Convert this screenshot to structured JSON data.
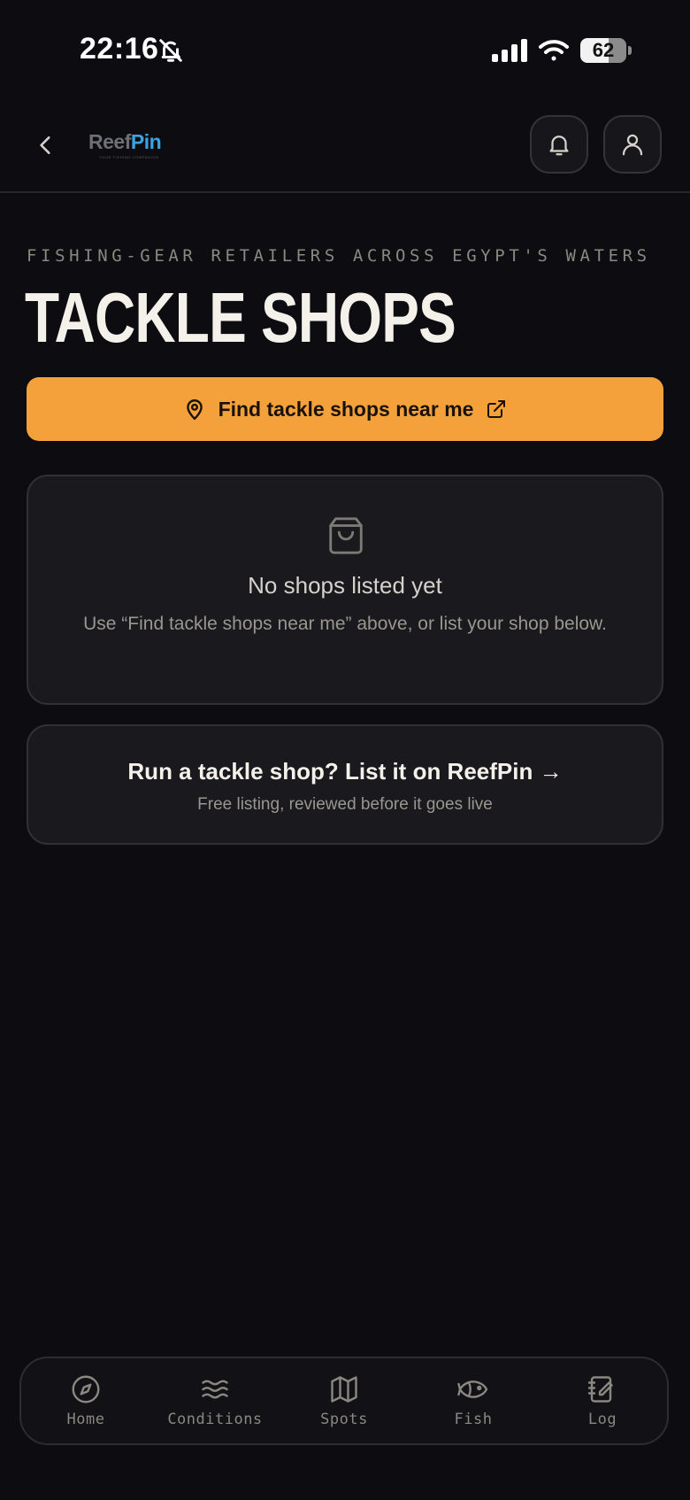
{
  "status_bar": {
    "time": "22:16",
    "battery": "62"
  },
  "header": {
    "logo_primary": "Reef",
    "logo_accent": "Pin",
    "logo_tagline": "YOUR FISHING COMPANION"
  },
  "page": {
    "eyebrow": "FISHING-GEAR RETAILERS ACROSS EGYPT'S WATERS",
    "title": "TACKLE SHOPS",
    "find_button_label": "Find tackle shops near me"
  },
  "empty_state": {
    "title": "No shops listed yet",
    "description": "Use “Find tackle shops near me” above, or list your shop below."
  },
  "list_cta": {
    "title": "Run a tackle shop? List it on ReefPin →",
    "subtitle": "Free listing, reviewed before it goes live"
  },
  "nav": {
    "items": [
      {
        "label": "Home",
        "icon": "compass-icon"
      },
      {
        "label": "Conditions",
        "icon": "waves-icon"
      },
      {
        "label": "Spots",
        "icon": "map-icon"
      },
      {
        "label": "Fish",
        "icon": "fish-icon"
      },
      {
        "label": "Log",
        "icon": "notebook-icon"
      }
    ]
  },
  "colors": {
    "background": "#0d0d11",
    "accent": "#f5a13b",
    "card": "#19191e",
    "text": "#f4f0ea",
    "muted": "#8a8880",
    "logo_accent": "#3aa3e0"
  }
}
